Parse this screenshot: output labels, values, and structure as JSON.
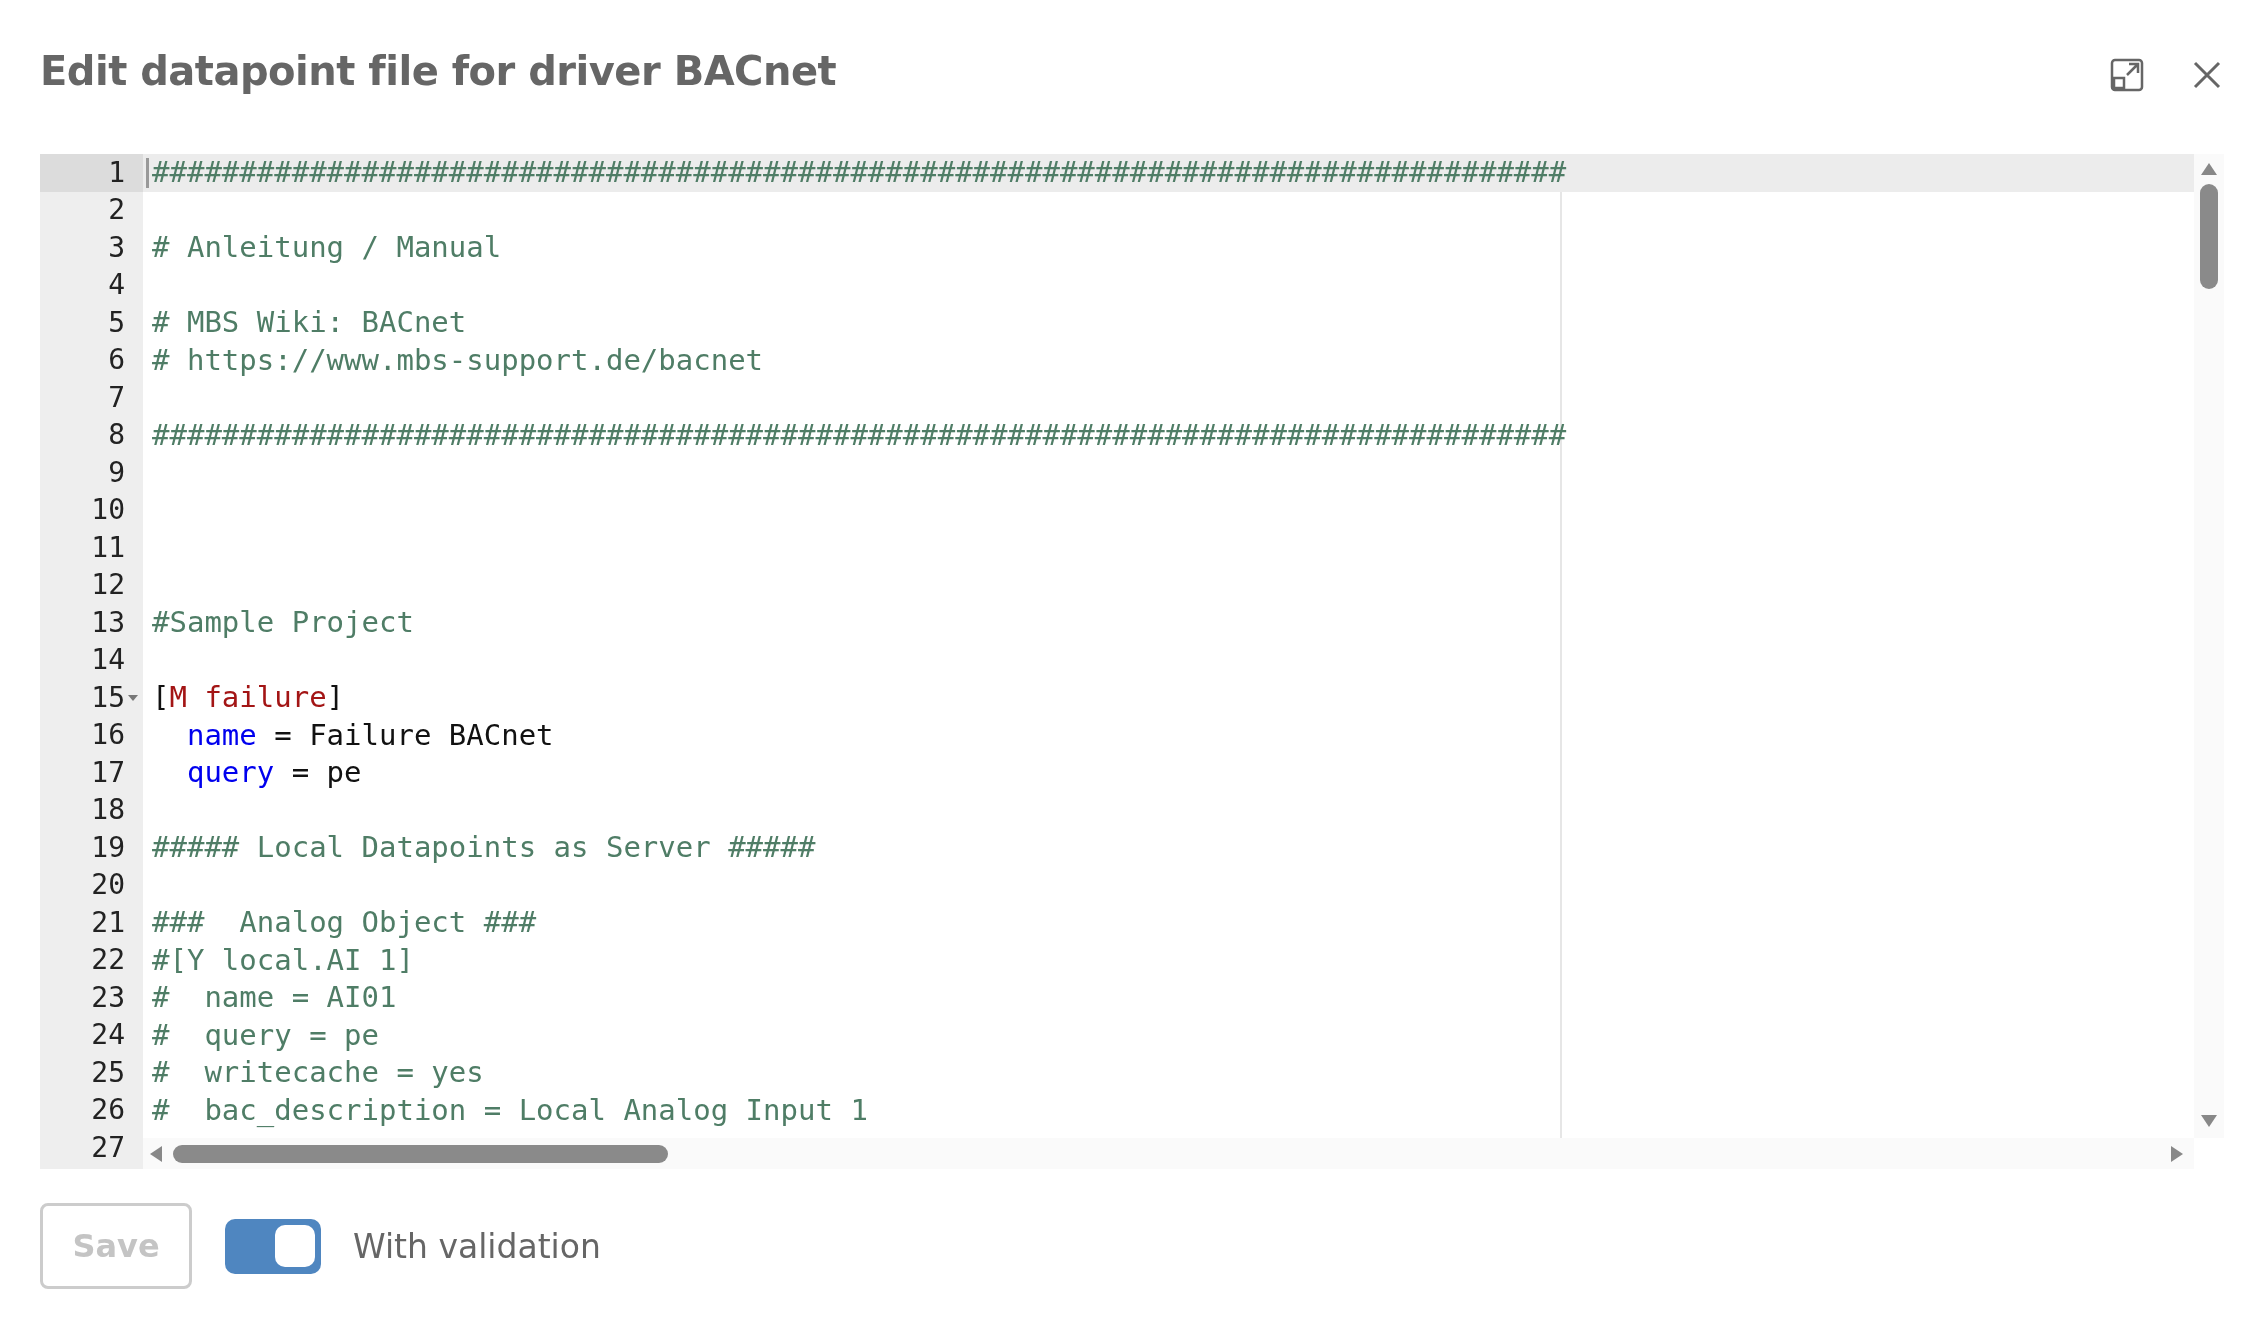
{
  "dialog": {
    "title": "Edit datapoint file for driver BACnet"
  },
  "editor": {
    "lines": [
      {
        "number": "1",
        "selected": true,
        "foldable": false,
        "segments": [
          {
            "kind": "comment",
            "text": "#################################################################################"
          }
        ]
      },
      {
        "number": "2",
        "selected": false,
        "foldable": false
      },
      {
        "number": "3",
        "selected": false,
        "foldable": false,
        "segments": [
          {
            "kind": "comment",
            "text": "# Anleitung / Manual"
          }
        ]
      },
      {
        "number": "4",
        "selected": false,
        "foldable": false
      },
      {
        "number": "5",
        "selected": false,
        "foldable": false,
        "segments": [
          {
            "kind": "comment",
            "text": "# MBS Wiki: BACnet"
          }
        ]
      },
      {
        "number": "6",
        "selected": false,
        "foldable": false,
        "segments": [
          {
            "kind": "comment",
            "text": "# https://www.mbs-support.de/bacnet"
          }
        ]
      },
      {
        "number": "7",
        "selected": false,
        "foldable": false
      },
      {
        "number": "8",
        "selected": false,
        "foldable": false,
        "segments": [
          {
            "kind": "comment",
            "text": "#################################################################################"
          }
        ]
      },
      {
        "number": "9",
        "selected": false,
        "foldable": false
      },
      {
        "number": "10",
        "selected": false,
        "foldable": false
      },
      {
        "number": "11",
        "selected": false,
        "foldable": false
      },
      {
        "number": "12",
        "selected": false,
        "foldable": false
      },
      {
        "number": "13",
        "selected": false,
        "foldable": false,
        "segments": [
          {
            "kind": "comment",
            "text": "#Sample Project"
          }
        ]
      },
      {
        "number": "14",
        "selected": false,
        "foldable": false
      },
      {
        "number": "15",
        "selected": false,
        "foldable": true,
        "segments": [
          {
            "kind": "plain",
            "text": "["
          },
          {
            "kind": "section",
            "text": "M failure"
          },
          {
            "kind": "plain",
            "text": "]"
          }
        ]
      },
      {
        "number": "16",
        "selected": false,
        "foldable": false,
        "segments": [
          {
            "kind": "key",
            "text": "  name"
          },
          {
            "kind": "plain",
            "text": " = Failure BACnet"
          }
        ]
      },
      {
        "number": "17",
        "selected": false,
        "foldable": false,
        "segments": [
          {
            "kind": "key",
            "text": "  query"
          },
          {
            "kind": "plain",
            "text": " = pe"
          }
        ]
      },
      {
        "number": "18",
        "selected": false,
        "foldable": false
      },
      {
        "number": "19",
        "selected": false,
        "foldable": false,
        "segments": [
          {
            "kind": "comment",
            "text": "##### Local Datapoints as Server #####"
          }
        ]
      },
      {
        "number": "20",
        "selected": false,
        "foldable": false
      },
      {
        "number": "21",
        "selected": false,
        "foldable": false,
        "segments": [
          {
            "kind": "comment",
            "text": "###  Analog Object ###"
          }
        ]
      },
      {
        "number": "22",
        "selected": false,
        "foldable": false,
        "segments": [
          {
            "kind": "comment",
            "text": "#[Y local.AI 1]"
          }
        ]
      },
      {
        "number": "23",
        "selected": false,
        "foldable": false,
        "segments": [
          {
            "kind": "comment",
            "text": "#  name = AI01"
          }
        ]
      },
      {
        "number": "24",
        "selected": false,
        "foldable": false,
        "segments": [
          {
            "kind": "comment",
            "text": "#  query = pe"
          }
        ]
      },
      {
        "number": "25",
        "selected": false,
        "foldable": false,
        "segments": [
          {
            "kind": "comment",
            "text": "#  writecache = yes"
          }
        ]
      },
      {
        "number": "26",
        "selected": false,
        "foldable": false,
        "segments": [
          {
            "kind": "comment",
            "text": "#  bac_description = Local Analog Input 1"
          }
        ]
      },
      {
        "number": "27",
        "selected": false,
        "foldable": false
      }
    ]
  },
  "footer": {
    "save_button": {
      "label": "Save",
      "disabled": true
    },
    "validation_toggle": {
      "label": "With validation",
      "on": true
    }
  }
}
